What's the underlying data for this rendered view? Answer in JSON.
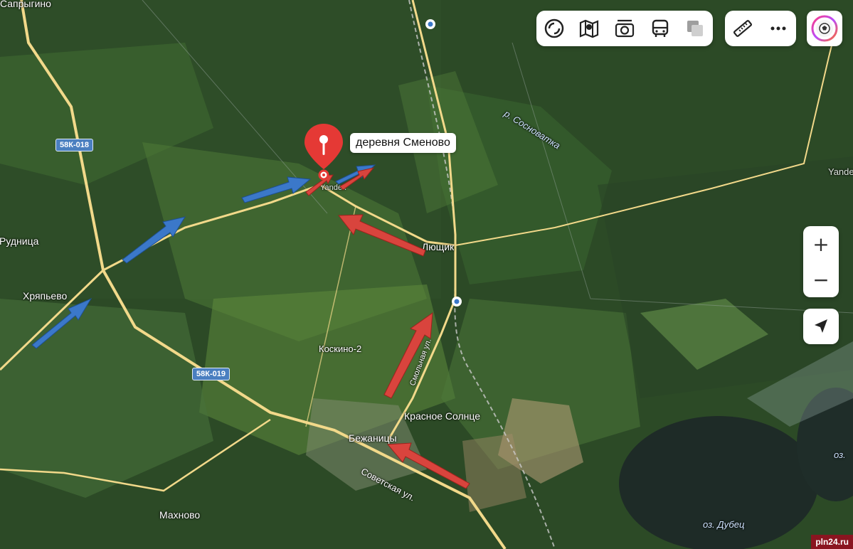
{
  "toolbar": {
    "items": [
      {
        "name": "layers-icon"
      },
      {
        "name": "map-guide-icon"
      },
      {
        "name": "panorama-icon"
      },
      {
        "name": "transit-icon"
      },
      {
        "name": "traffic-icon"
      }
    ],
    "tools": [
      {
        "name": "ruler-icon"
      },
      {
        "name": "more-icon"
      }
    ]
  },
  "pin": {
    "label": "деревня Сменово",
    "color": "#e53935"
  },
  "places": {
    "saprygino": "Сапрыгино",
    "rudnitsa": "Рудница",
    "khryapyevo": "Хряпьево",
    "lyushchik": "Лющик",
    "koskino": "Коскино-2",
    "krasnoe_solntse": "Красное Солнце",
    "bezhanitsy": "Бежаницы",
    "makhnovo": "Махново",
    "dubets": "оз. Дубец",
    "oz": "оз.",
    "yandex_edge": "Yande",
    "yandex_under_pin": "Yandex"
  },
  "streets": {
    "sovetskaya": "Советская ул.",
    "smolnaya": "Смольная ул."
  },
  "water": {
    "river": "р. Сосноватка"
  },
  "roads": {
    "r1": "58К-018",
    "r2": "58К-019"
  },
  "controls": {
    "zoom_in": "+",
    "zoom_out": "−"
  },
  "watermark": "pln24.ru",
  "colors": {
    "arrow_blue": "#3b78c9",
    "arrow_red": "#d9443d",
    "road": "#f2d98a",
    "forest_dark": "#24401f",
    "field_light": "#5f8a3c",
    "lake": "#1e2b27"
  }
}
